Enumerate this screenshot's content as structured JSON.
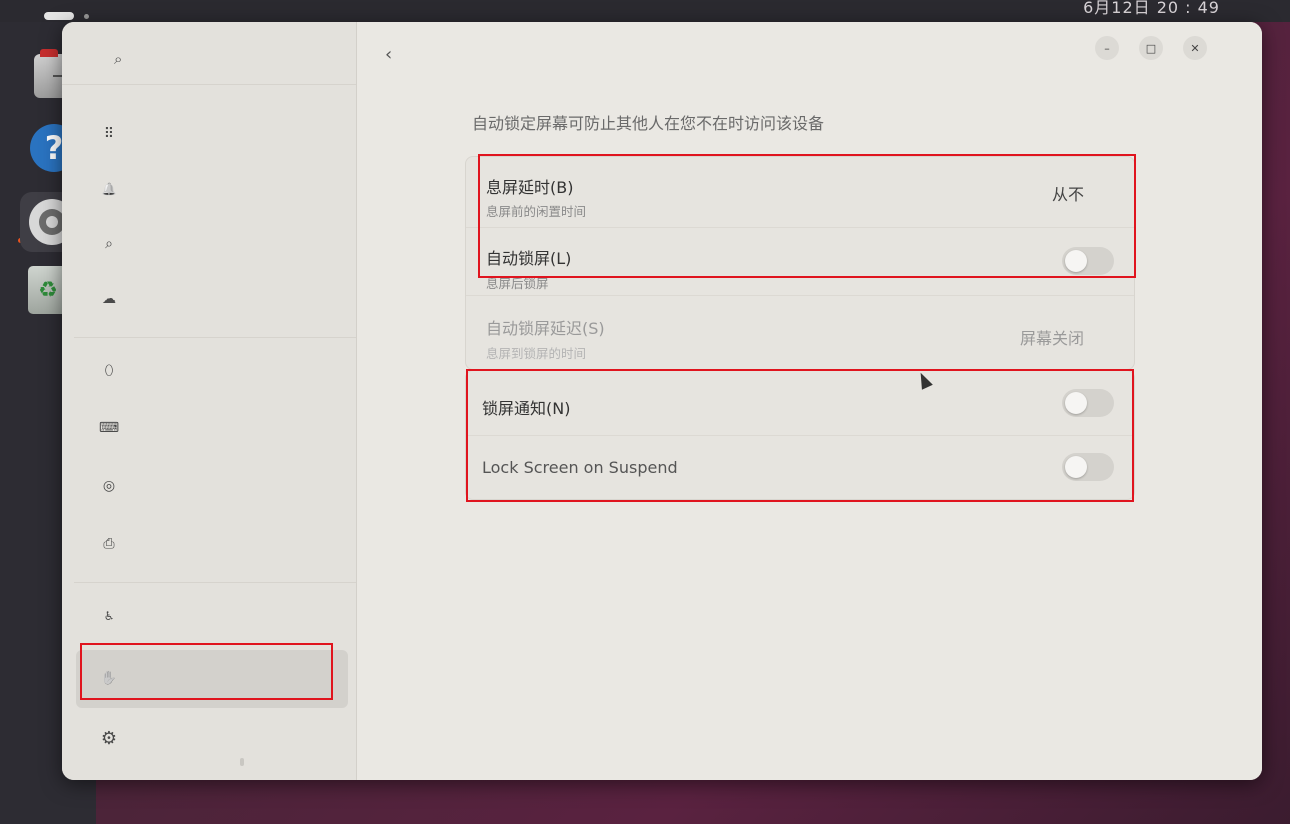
{
  "topbar": {
    "clock": "6月12日  20 : 49"
  },
  "dock": {
    "items": [
      {
        "name": "files-icon"
      },
      {
        "name": "help-icon",
        "glyph": "?"
      },
      {
        "name": "settings-icon"
      },
      {
        "name": "trash-icon",
        "glyph": "♻"
      }
    ]
  },
  "sidebar": {
    "icons": {
      "search": "⌕",
      "apps": "⠿",
      "notifications": "🔔",
      "search_nav": "⌕",
      "online_accounts": "☁",
      "mouse": "⬯",
      "keyboard": "⌨",
      "color": "◎",
      "printers": "⎙",
      "accessibility": "♿",
      "privacy": "✋",
      "system": "⚙"
    }
  },
  "window": {
    "back_icon": "‹",
    "minimize": "–",
    "maximize": "□",
    "close": "✕"
  },
  "main": {
    "intro": "自动锁定屏幕可防止其他人在您不在时访问该设备",
    "blank_delay": {
      "title": "息屏延时(B)",
      "subtitle": "息屏前的闲置时间",
      "value": "从不"
    },
    "auto_lock": {
      "title": "自动锁屏(L)",
      "subtitle": "息屏后锁屏",
      "enabled": false
    },
    "auto_lock_delay": {
      "title": "自动锁屏延迟(S)",
      "subtitle": "息屏到锁屏的时间",
      "value": "屏幕关闭"
    },
    "lock_notifications": {
      "title": "锁屏通知(N)",
      "enabled": false
    },
    "lock_on_suspend": {
      "title": "Lock Screen on Suspend",
      "enabled": false
    }
  },
  "colors": {
    "highlight": "#e0141e"
  }
}
